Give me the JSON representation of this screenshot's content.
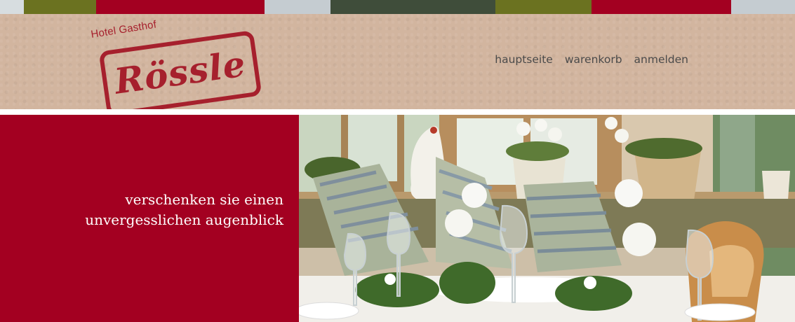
{
  "colors": {
    "stripe": [
      "#d7dde0",
      "#6b7220",
      "#a30021",
      "#c5ccd1",
      "#3f4d3a",
      "#6b7220",
      "#a30021",
      "#c5ccd1"
    ],
    "header_bg": "#d2b59f",
    "brand_red": "#a30021",
    "nav_text": "#4a4a4a"
  },
  "logo": {
    "subtitle": "Hotel Gasthof",
    "name": "Rössle"
  },
  "nav": {
    "items": [
      {
        "label": "hauptseite"
      },
      {
        "label": "warenkorb"
      },
      {
        "label": "anmelden"
      }
    ]
  },
  "promo": {
    "line1": "verschenken sie einen",
    "line2": "unvergesslichen augenblick"
  },
  "hero_image": {
    "icon": "table-setting-photo"
  }
}
